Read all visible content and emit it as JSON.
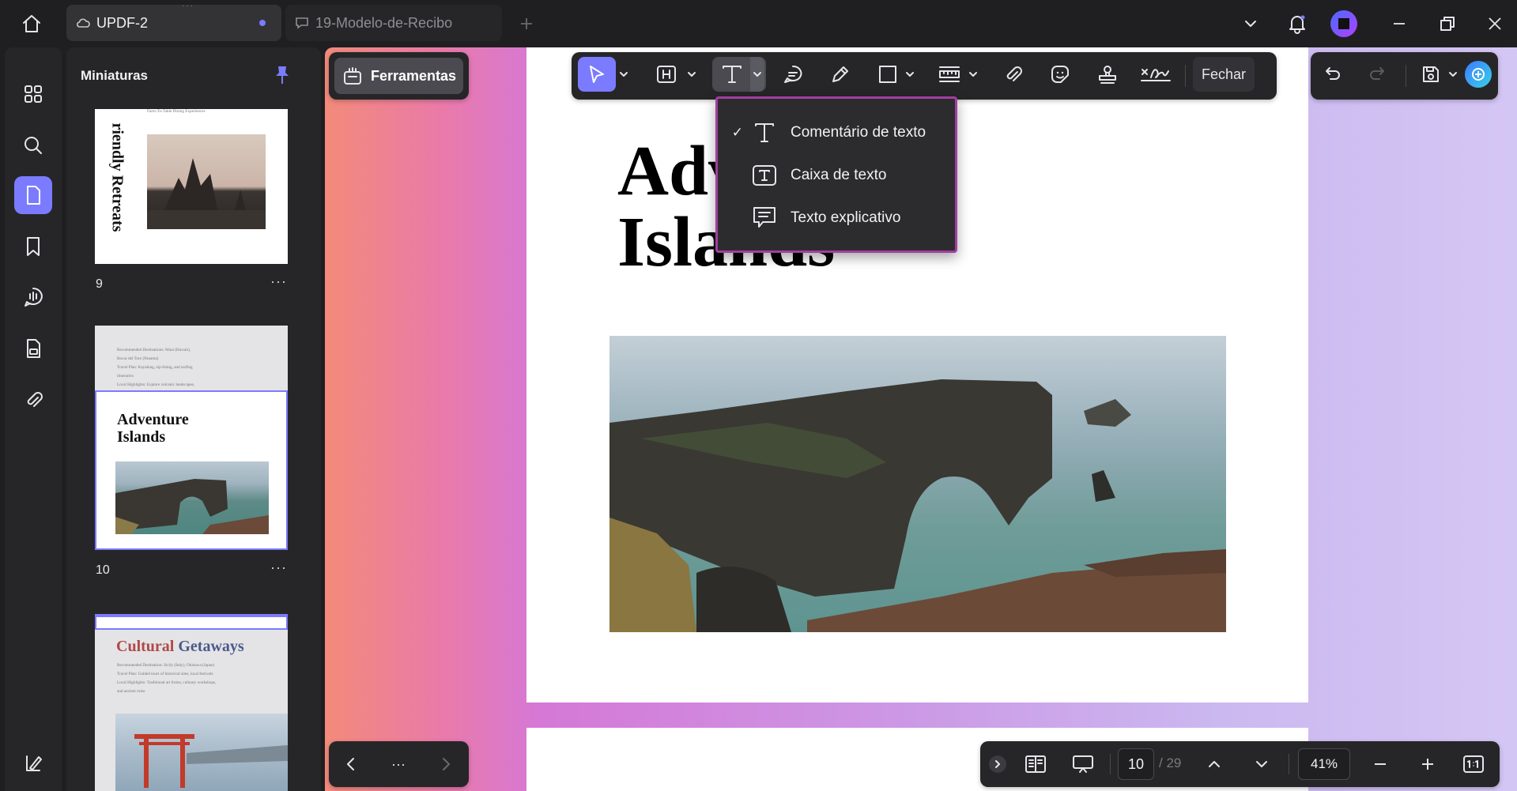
{
  "tabs": [
    {
      "label": "UPDF-2",
      "active": true
    },
    {
      "label": "19-Modelo-de-Recibo",
      "active": false
    }
  ],
  "sidebar": {
    "title": "Miniaturas"
  },
  "thumbnails": [
    {
      "num": "9",
      "title": "riendly Retreats",
      "caption": "Farm-To-Table Dining Experiences"
    },
    {
      "num": "10",
      "title_line1": "Adventure",
      "title_line2": "Islands",
      "text_lines": [
        "Recommended Destinations: Maui (Hawaii),",
        "Bocas del Toro (Panama)",
        "Travel Plan: Kayaking, zip-lining, and surfing",
        "itineraries",
        "Local Highlights: Explore volcanic landscapes,"
      ]
    },
    {
      "num": "",
      "title_a": "Cultural",
      "title_b": "Getaways",
      "text_lines": [
        "Recommended Destination: Sicily (Italy), Okinawa (Japan)",
        "Travel Plan: Guided tours of historical sites, local festivals",
        "Local Highlights: Traditional art forms, culinary workshops,",
        "and ancient ruins"
      ]
    }
  ],
  "tools_button": "Ferramentas",
  "close_button": "Fechar",
  "document": {
    "title_line1": "Adv",
    "title_line2": "Islands"
  },
  "dropdown": {
    "items": [
      {
        "label": "Comentário de texto",
        "checked": true
      },
      {
        "label": "Caixa de texto",
        "checked": false
      },
      {
        "label": "Texto explicativo",
        "checked": false
      }
    ]
  },
  "pagination": {
    "current": "10",
    "total": "/ 29"
  },
  "zoom": "41%",
  "colors": {
    "accent": "#7b7bff",
    "highlight_border": "#a23ea0"
  }
}
